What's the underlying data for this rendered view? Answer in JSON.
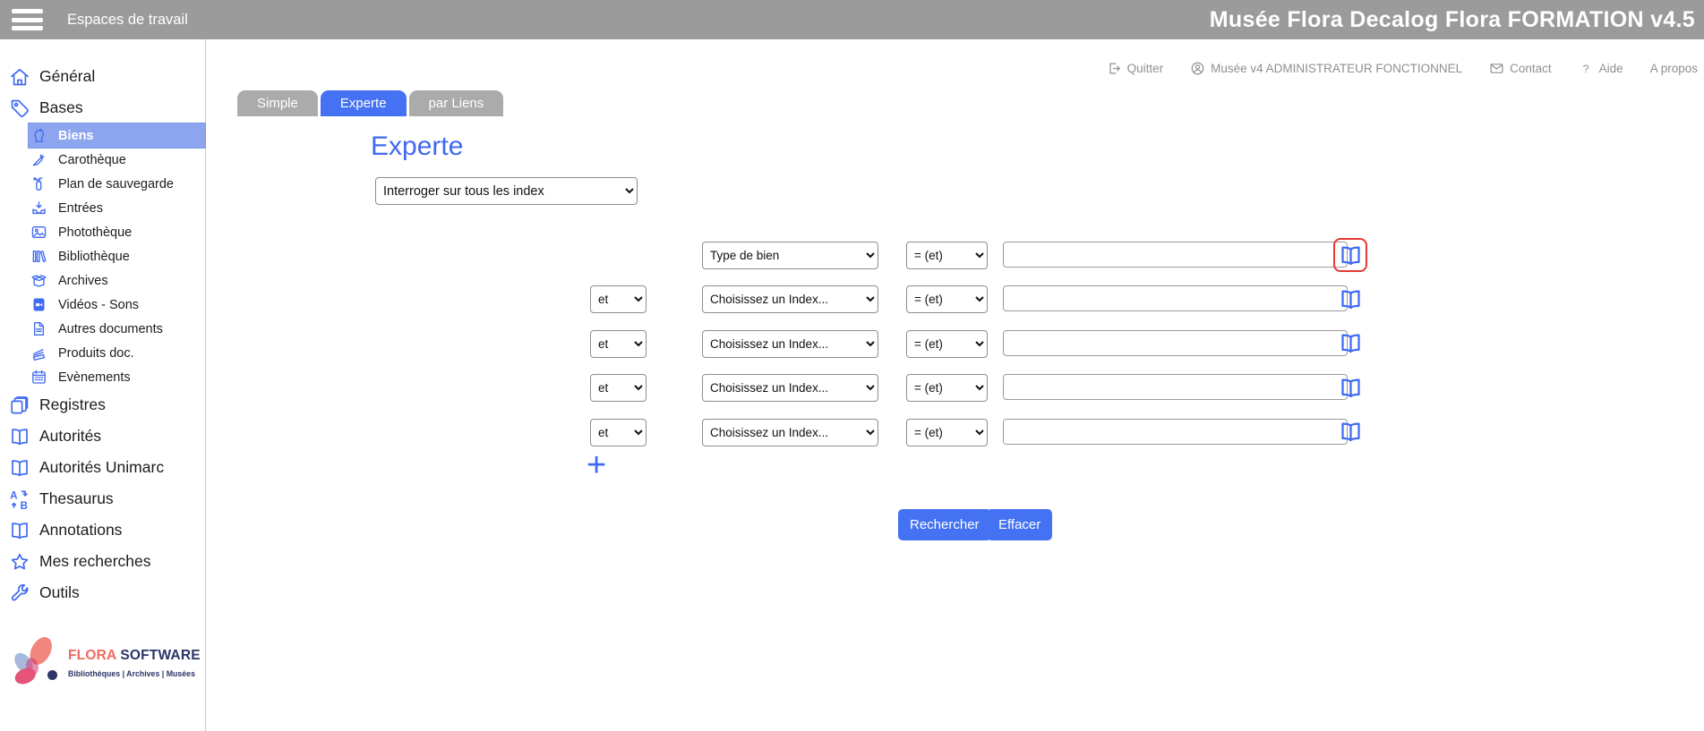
{
  "header": {
    "menu_icon": "hamburger-icon",
    "workspace_label": "Espaces de travail",
    "app_title": "Musée Flora Decalog Flora FORMATION v4.5"
  },
  "utility_bar": {
    "items": [
      {
        "icon": "logout-icon",
        "label": "Quitter"
      },
      {
        "icon": "user-circle-icon",
        "label": "Musée v4 ADMINISTRATEUR FONCTIONNEL"
      },
      {
        "icon": "mail-icon",
        "label": "Contact"
      },
      {
        "icon": "question-icon",
        "label": "Aide"
      },
      {
        "icon": null,
        "label": "A propos"
      }
    ]
  },
  "sidebar": {
    "items": [
      {
        "label": "Général",
        "icon": "home-icon",
        "level": 0,
        "selected": false
      },
      {
        "label": "Bases",
        "icon": "tag-icon",
        "level": 0,
        "selected": false
      },
      {
        "label": "Biens",
        "icon": "bust-icon",
        "level": 1,
        "selected": true
      },
      {
        "label": "Carothèque",
        "icon": "carrot-icon",
        "level": 1,
        "selected": false
      },
      {
        "label": "Plan de sauvegarde",
        "icon": "extinguisher-icon",
        "level": 1,
        "selected": false
      },
      {
        "label": "Entrées",
        "icon": "inbox-arrow-icon",
        "level": 1,
        "selected": false
      },
      {
        "label": "Photothèque",
        "icon": "photo-icon",
        "level": 1,
        "selected": false
      },
      {
        "label": "Bibliothèque",
        "icon": "books-icon",
        "level": 1,
        "selected": false
      },
      {
        "label": "Archives",
        "icon": "open-box-icon",
        "level": 1,
        "selected": false
      },
      {
        "label": "Vidéos - Sons",
        "icon": "video-file-icon",
        "level": 1,
        "selected": false
      },
      {
        "label": "Autres documents",
        "icon": "document-icon",
        "level": 1,
        "selected": false
      },
      {
        "label": "Produits doc.",
        "icon": "paper-stack-icon",
        "level": 1,
        "selected": false
      },
      {
        "label": "Evènements",
        "icon": "calendar-icon",
        "level": 1,
        "selected": false
      },
      {
        "label": "Registres",
        "icon": "copies-icon",
        "level": 0,
        "selected": false
      },
      {
        "label": "Autorités",
        "icon": "open-book-icon",
        "level": 0,
        "selected": false
      },
      {
        "label": "Autorités Unimarc",
        "icon": "open-book-icon",
        "level": 0,
        "selected": false
      },
      {
        "label": "Thesaurus",
        "icon": "sort-ab-icon",
        "level": 0,
        "selected": false
      },
      {
        "label": "Annotations",
        "icon": "open-book-icon",
        "level": 0,
        "selected": false
      },
      {
        "label": "Mes recherches",
        "icon": "star-icon",
        "level": 0,
        "selected": false
      },
      {
        "label": "Outils",
        "icon": "wrench-icon",
        "level": 0,
        "selected": false
      }
    ],
    "logo": {
      "brand_primary": "FLORA",
      "brand_secondary": "SOFTWARE",
      "tagline": "Bibliothèques | Archives | Musées"
    }
  },
  "tabs": [
    {
      "label": "Simple",
      "active": false
    },
    {
      "label": "Experte",
      "active": true
    },
    {
      "label": "par Liens",
      "active": false
    }
  ],
  "main": {
    "heading": "Experte",
    "index_scope_select": "Interroger sur tous les index",
    "rows": [
      {
        "bool": null,
        "index": "Type de bien",
        "operator": "= (et)",
        "value": "",
        "lookup_icon": "open-book-icon",
        "highlighted": true
      },
      {
        "bool": "et",
        "index": "Choisissez un Index...",
        "operator": "= (et)",
        "value": "",
        "lookup_icon": "open-book-icon",
        "highlighted": false
      },
      {
        "bool": "et",
        "index": "Choisissez un Index...",
        "operator": "= (et)",
        "value": "",
        "lookup_icon": "open-book-icon",
        "highlighted": false
      },
      {
        "bool": "et",
        "index": "Choisissez un Index...",
        "operator": "= (et)",
        "value": "",
        "lookup_icon": "open-book-icon",
        "highlighted": false
      },
      {
        "bool": "et",
        "index": "Choisissez un Index...",
        "operator": "= (et)",
        "value": "",
        "lookup_icon": "open-book-icon",
        "highlighted": false
      }
    ],
    "add_row_label": "+",
    "search_button": "Rechercher",
    "clear_button": "Effacer"
  },
  "colors": {
    "header_gray": "#9b9b9b",
    "accent_blue": "#3f6af3",
    "tab_active_blue": "#4472f2",
    "selected_item_bg": "#8da5ee",
    "tab_inactive_gray": "#ababab",
    "highlight_red": "#e53935",
    "utility_text_gray": "#8f8f8f",
    "logo_coral": "#ee685f",
    "logo_navy": "#2b3566"
  }
}
